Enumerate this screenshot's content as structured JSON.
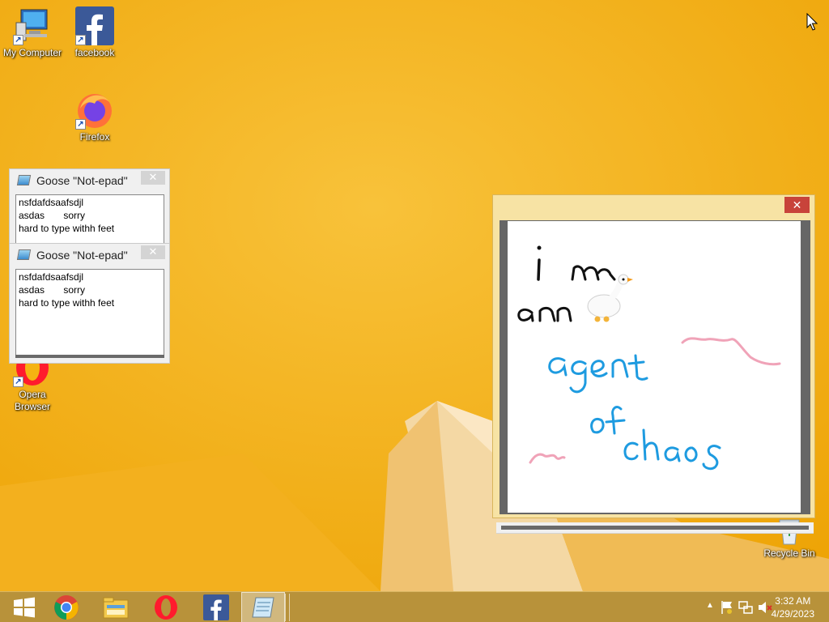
{
  "desktop": {
    "icons": [
      {
        "label": "My Computer",
        "icon": "computer-icon"
      },
      {
        "label": "facebook",
        "icon": "facebook-icon"
      },
      {
        "label": "Firefox",
        "icon": "firefox-icon"
      },
      {
        "label": "Opera\nBrowser",
        "icon": "opera-icon"
      },
      {
        "label": "Recycle Bin",
        "icon": "recycle-bin-icon"
      }
    ]
  },
  "notepads": [
    {
      "title": "Goose \"Not-epad\"",
      "close": "✕",
      "text": "nsfdafdsaafsdjl\nasdas       sorry\nhard to type withh feet"
    },
    {
      "title": "Goose \"Not-epad\"",
      "close": "✕",
      "text": "nsfdafdsaafsdjl\nasdas       sorry\nhard to type withh feet"
    }
  ],
  "drawing": {
    "close": "✕",
    "words": [
      "i",
      "m",
      "an",
      "agent",
      "of",
      "chaos"
    ]
  },
  "taskbar": {
    "apps": [
      "start-icon",
      "chrome-icon",
      "file-explorer-icon",
      "opera-icon",
      "facebook-icon",
      "notepad-icon"
    ],
    "time": "3:32 AM",
    "date": "4/29/2023"
  },
  "colors": {
    "wallpaper": "#f5b312",
    "taskbar": "#b8923a",
    "blue_ink": "#1e9be0",
    "pink_ink": "#f0a3b8"
  }
}
